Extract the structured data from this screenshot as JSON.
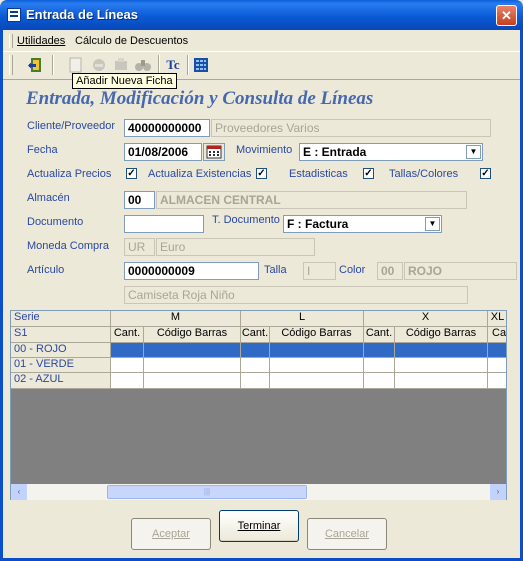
{
  "window": {
    "title": "Entrada de Líneas",
    "close_glyph": "✕"
  },
  "menu": [
    {
      "label": "Utilidades"
    },
    {
      "label": "Cálculo de Descuentos"
    }
  ],
  "toolbar": {
    "tooltip": "Añadir Nueva Ficha",
    "tc_label": "Tc",
    "icons": [
      "exit-door-icon",
      "new-record-icon",
      "save-icon",
      "delete-icon",
      "search-binoculars-icon",
      "tc-icon",
      "grid-calculator-icon"
    ]
  },
  "heading": "Entrada, Modificación y Consulta de Líneas",
  "form": {
    "cliente_label": "Cliente/Proveedor",
    "cliente_code": "40000000000",
    "cliente_name": "Proveedores Varios",
    "fecha_label": "Fecha",
    "fecha_value": "01/08/2006",
    "movimiento_label": "Movimiento",
    "movimiento_value": "E : Entrada",
    "actualiza_precios_label": "Actualiza Precios",
    "actualiza_existencias_label": "Actualiza Existencias",
    "estadisticas_label": "Estadisticas",
    "tallas_colores_label": "Tallas/Colores",
    "check_glyph": "✓",
    "almacen_label": "Almacén",
    "almacen_code": "00",
    "almacen_name": "ALMACEN CENTRAL",
    "documento_label": "Documento",
    "documento_value": "",
    "tdocumento_label": "T. Documento",
    "tdocumento_value": "F : Factura",
    "moneda_label": "Moneda Compra",
    "moneda_code": "UR",
    "moneda_name": "Euro",
    "articulo_label": "Artículo",
    "articulo_code": "0000000009",
    "talla_label": "Talla",
    "talla_value": "I",
    "color_label": "Color",
    "color_code": "00",
    "color_name": "ROJO",
    "articulo_desc": "Camiseta Roja Niño"
  },
  "grid": {
    "serie_label": "Serie",
    "s1_label": "S1",
    "sizes": [
      "M",
      "L",
      "X",
      "XL"
    ],
    "cant_label": "Cant.",
    "codigo_label": "Código Barras",
    "partial_label": "Ca",
    "rows": [
      "00 - ROJO",
      "01 - VERDE",
      "02 - AZUL"
    ]
  },
  "scroll": {
    "left": "‹",
    "right": "›",
    "thumb": "|||"
  },
  "buttons": {
    "aceptar": "Aceptar",
    "terminar": "Terminar",
    "cancelar": "Cancelar"
  }
}
